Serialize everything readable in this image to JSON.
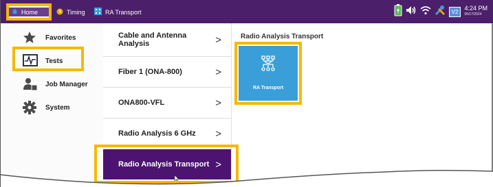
{
  "topbar": {
    "tabs": [
      {
        "label": "Home",
        "icon": "home-icon"
      },
      {
        "label": "Timing",
        "icon": "timing-icon"
      },
      {
        "label": "RA Transport",
        "icon": "ra-transport-icon"
      }
    ],
    "status": {
      "badge": "V2",
      "time": "4:24 PM",
      "date": "06/17/2024",
      "icons": [
        "battery-icon",
        "volume-icon",
        "wifi-icon",
        "tools-icon"
      ]
    }
  },
  "nav": {
    "items": [
      {
        "label": "Favorites",
        "icon": "star-icon"
      },
      {
        "label": "Tests",
        "icon": "waveform-icon",
        "selected": true
      },
      {
        "label": "Job Manager",
        "icon": "job-manager-icon"
      },
      {
        "label": "System",
        "icon": "gear-icon"
      }
    ]
  },
  "tests": {
    "items": [
      {
        "label": "Cable and Antenna Analysis"
      },
      {
        "label": "Fiber 1 (ONA-800)"
      },
      {
        "label": "ONA800-VFL"
      },
      {
        "label": "Radio Analysis 6 GHz"
      },
      {
        "label": "Radio Analysis Transport",
        "selected": true
      }
    ],
    "chevron": ">"
  },
  "panel": {
    "title": "Radio Analysis Transport",
    "tile": {
      "label": "RA Transport",
      "icon": "network-tree-icon",
      "color": "#3a9fd8"
    }
  },
  "colors": {
    "brand": "#4c1f6b",
    "selected_row": "#4c1470",
    "highlight": "#f6b800"
  }
}
